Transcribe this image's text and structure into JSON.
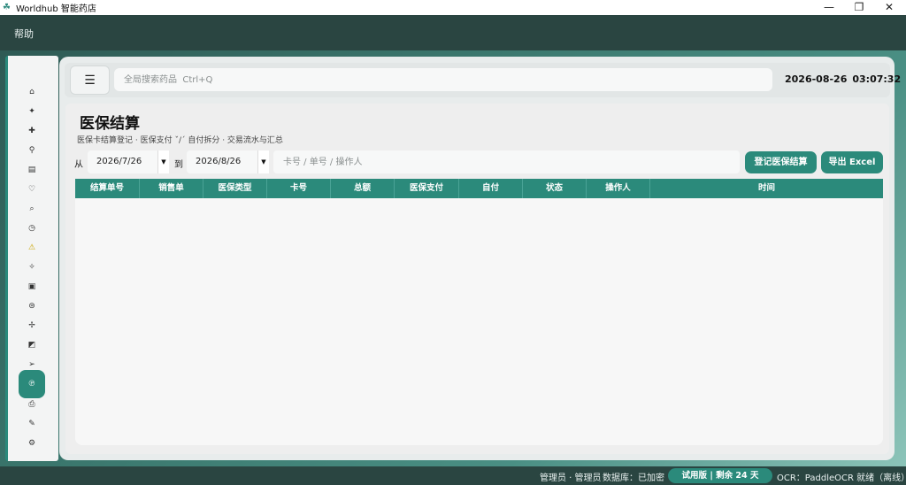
{
  "window": {
    "title": "Worldhub 智能药店",
    "app_icon": "leaf-icon",
    "controls": [
      "minimize-icon",
      "maximize-icon",
      "close-icon"
    ]
  },
  "menubar": {
    "items": [
      "帮助"
    ]
  },
  "sidebar": {
    "items": [
      {
        "icon": "home-icon"
      },
      {
        "icon": "sparkle-icon"
      },
      {
        "icon": "plus-icon"
      },
      {
        "icon": "pin-icon"
      },
      {
        "icon": "document-icon"
      },
      {
        "icon": "heart-icon"
      },
      {
        "icon": "search-icon"
      },
      {
        "icon": "clock-icon"
      },
      {
        "icon": "warning-icon"
      },
      {
        "icon": "pill-icon"
      },
      {
        "icon": "box-icon"
      },
      {
        "icon": "dollar-icon"
      },
      {
        "icon": "star-icon"
      },
      {
        "icon": "edit-icon"
      },
      {
        "icon": "send-icon"
      },
      {
        "icon": "insurance-icon",
        "active": true
      },
      {
        "icon": "printer-icon"
      },
      {
        "icon": "link-icon"
      },
      {
        "icon": "settings-icon"
      }
    ]
  },
  "topbar": {
    "menu_icon": "hamburger-icon",
    "search_placeholder": "全局搜索药品  Ctrl+Q",
    "date": "2026-08-26",
    "time": "03:07:32"
  },
  "page": {
    "title": "医保结算",
    "subtitle": "医保卡结算登记 · 医保支付 ˇ/ˊ 自付拆分 · 交易流水与汇总"
  },
  "filters": {
    "from_label": "从",
    "from_date": "2026/7/26",
    "to_label": "到",
    "to_date": "2026/8/26",
    "search_placeholder": "卡号 / 单号 / 操作人",
    "register_button": "登记医保结算",
    "export_button": "导出 Excel"
  },
  "table": {
    "columns": [
      "结算单号",
      "销售单",
      "医保类型",
      "卡号",
      "总额",
      "医保支付",
      "自付",
      "状态",
      "操作人",
      "时间"
    ],
    "rows": []
  },
  "statusbar": {
    "user": "管理员 · 管理员",
    "database": "数据库：已加密",
    "trial": "试用版 | 剩余 24 天",
    "ocr": "OCR：PaddleOCR 就绪（离线）"
  },
  "colors": {
    "accent": "#2b8a7b",
    "dark_bar": "#2a4541",
    "panel_bg": "#eeeeee"
  }
}
